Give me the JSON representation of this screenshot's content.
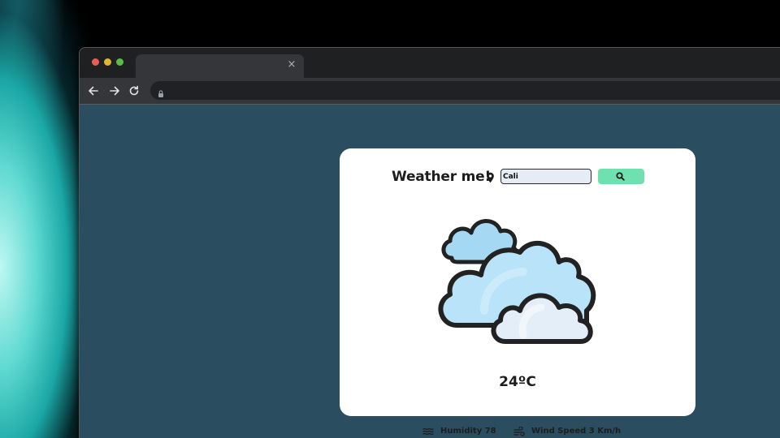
{
  "browser": {
    "tab": {
      "title": "",
      "close_icon": "×"
    },
    "address": {
      "url": ""
    }
  },
  "app": {
    "title": "Weather me!",
    "search": {
      "value": "Cali",
      "placeholder": ""
    },
    "weather_icon": "cloudy-icon",
    "temperature": "24ºC",
    "humidity_label": "Humidity 78",
    "wind_label": "Wind Speed 3 Km/h"
  },
  "colors": {
    "page_background": "#2b4d60",
    "card_background": "#ffffff",
    "search_button": "#6fe0b0",
    "search_input_fill": "#e6ecf6"
  }
}
